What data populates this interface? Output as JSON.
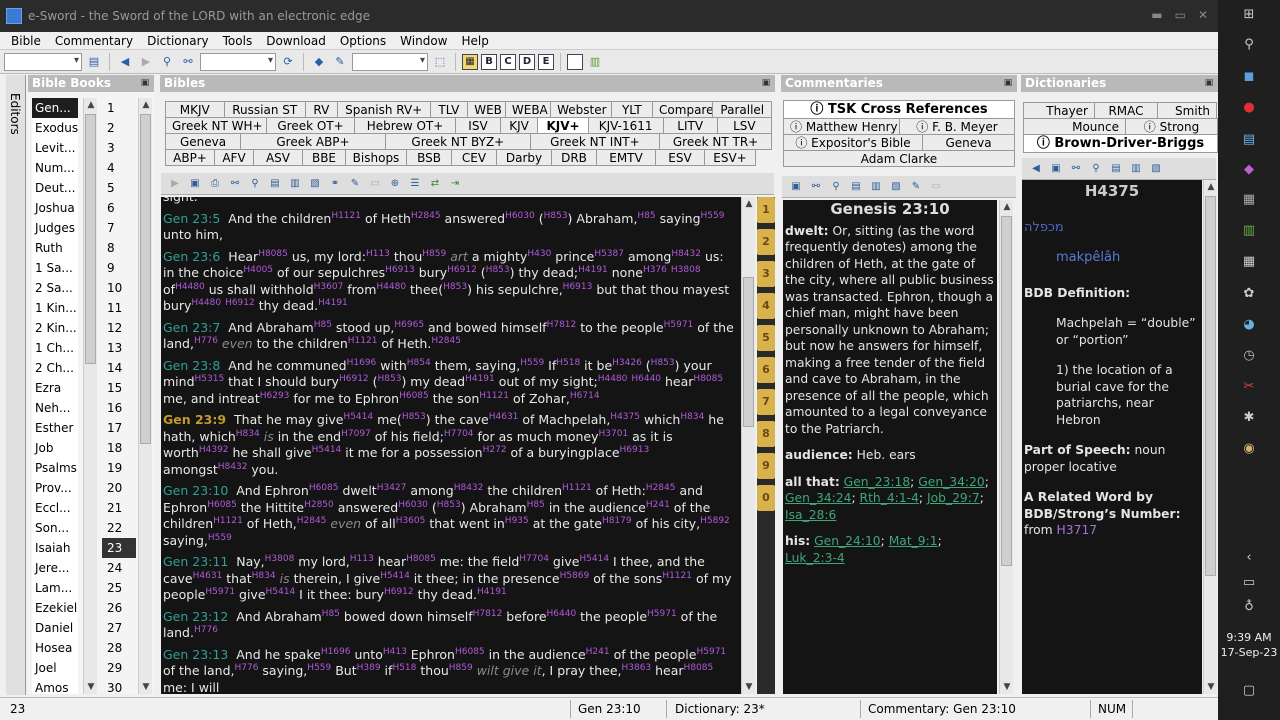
{
  "title": "e-Sword - the Sword of the LORD with an electronic edge",
  "menu": [
    "Bible",
    "Commentary",
    "Dictionary",
    "Tools",
    "Download",
    "Options",
    "Window",
    "Help"
  ],
  "toolbar_letters": [
    "B",
    "C",
    "D",
    "E"
  ],
  "editors_label": "Editors",
  "panels": {
    "bible_books": "Bible Books",
    "bibles": "Bibles",
    "commentaries": "Commentaries",
    "dictionaries": "Dictionaries"
  },
  "books": [
    "Gen...",
    "Exodus",
    "Levit...",
    "Num...",
    "Deut...",
    "Joshua",
    "Judges",
    "Ruth",
    "1 Sa...",
    "2 Sa...",
    "1 Kin...",
    "2 Kin...",
    "1 Ch...",
    "2 Ch...",
    "Ezra",
    "Neh...",
    "Esther",
    "Job",
    "Psalms",
    "Prov...",
    "Eccl...",
    "Son...",
    "Isaiah",
    "Jere...",
    "Lam...",
    "Ezekiel",
    "Daniel",
    "Hosea",
    "Joel",
    "Amos"
  ],
  "selected_book": "Gen...",
  "chapters": [
    "1",
    "2",
    "3",
    "4",
    "5",
    "6",
    "7",
    "8",
    "9",
    "10",
    "11",
    "12",
    "13",
    "14",
    "15",
    "16",
    "17",
    "18",
    "19",
    "20",
    "21",
    "22",
    "23",
    "24",
    "25",
    "26",
    "27",
    "28",
    "29",
    "30"
  ],
  "selected_chapter": "23",
  "bible_tabs": [
    [
      "MKJV",
      "Russian ST",
      "RV",
      "Spanish RV+",
      "TLV",
      "WEB",
      "WEBA",
      "Webster",
      "YLT",
      "Compare",
      "Parallel"
    ],
    [
      "Greek NT WH+",
      "Greek OT+",
      "Hebrew OT+",
      "ISV",
      "KJV",
      "KJV+",
      "KJV-1611",
      "LITV",
      "LSV"
    ],
    [
      "Geneva",
      "Greek ABP+",
      "Greek NT BYZ+",
      "Greek NT INT+",
      "Greek NT TR+"
    ],
    [
      "ABP+",
      "AFV",
      "ASV",
      "BBE",
      "Bishops",
      "BSB",
      "CEV",
      "Darby",
      "DRB",
      "EMTV",
      "ESV",
      "ESV+"
    ]
  ],
  "selected_bible_tab": "KJV+",
  "comm_tabs": {
    "top": "TSK Cross References",
    "row2": [
      "Matthew Henry",
      "F. B. Meyer"
    ],
    "row3": [
      "Expositor's Bible",
      "Geneva"
    ],
    "row4": "Adam Clarke"
  },
  "dict_tabs": {
    "row1": [
      "Thayer",
      "RMAC",
      "Smith"
    ],
    "row2": [
      "Mounce",
      "Strong"
    ],
    "row3": "Brown-Driver-Briggs"
  },
  "chapter_strip": [
    "1",
    "2",
    "3",
    "4",
    "5",
    "6",
    "7",
    "8",
    "9",
    "0"
  ],
  "verses": {
    "top_fragment": "sight.",
    "v5": {
      "ref": "Gen 23:5",
      "text": "And the children<sup>H1121</sup> of Heth<sup>H2845</sup> answered<sup>H6030</sup> (<sup>H853</sup>) Abraham,<sup>H85</sup> saying<sup>H559</sup> unto him,"
    },
    "v6": {
      "ref": "Gen 23:6",
      "text": "Hear<sup>H8085</sup> us, my lord:<sup>H113</sup> thou<sup>H859</sup> <span class=\"it\">art</span> a mighty<sup>H430</sup> prince<sup>H5387</sup> among<sup>H8432</sup> us: in the choice<sup>H4005</sup> of our sepulchres<sup>H6913</sup> bury<sup>H6912</sup> (<sup>H853</sup>) thy dead;<sup>H4191</sup> none<sup>H376</sup> <sup>H3808</sup> of<sup>H4480</sup> us shall withhold<sup>H3607</sup> from<sup>H4480</sup> thee(<sup>H853</sup>) his sepulchre,<sup>H6913</sup> but that thou mayest bury<sup>H4480</sup> <sup>H6912</sup> thy dead.<sup>H4191</sup>"
    },
    "v7": {
      "ref": "Gen 23:7",
      "text": "And Abraham<sup>H85</sup> stood up,<sup>H6965</sup> and bowed himself<sup>H7812</sup> to the people<sup>H5971</sup> of the land,<sup>H776</sup> <span class=\"it\">even</span> to the children<sup>H1121</sup> of Heth.<sup>H2845</sup>"
    },
    "v8": {
      "ref": "Gen 23:8",
      "text": "And he communed<sup>H1696</sup> with<sup>H854</sup> them, saying,<sup>H559</sup> If<sup>H518</sup> it be<sup>H3426</sup> (<sup>H853</sup>) your mind<sup>H5315</sup> that I should bury<sup>H6912</sup> (<sup>H853</sup>) my dead<sup>H4191</sup> out of my sight;<sup>H4480</sup> <sup>H6440</sup> hear<sup>H8085</sup> me, and intreat<sup>H6293</sup> for me to Ephron<sup>H6085</sup> the son<sup>H1121</sup> of Zohar,<sup>H6714</sup>"
    },
    "v9": {
      "ref": "Gen 23:9",
      "text": "That he may give<sup>H5414</sup> me(<sup>H853</sup>) the cave<sup>H4631</sup> of Machpelah,<sup>H4375</sup> which<sup>H834</sup> he hath, which<sup>H834</sup> <span class=\"it\">is</span> in the end<sup>H7097</sup> of his field;<sup>H7704</sup> for as much money<sup>H3701</sup> as it is worth<sup>H4392</sup> he shall give<sup>H5414</sup> it me for a possession<sup>H272</sup> of a buryingplace<sup>H6913</sup> amongst<sup>H8432</sup> you."
    },
    "v10": {
      "ref": "Gen 23:10",
      "text": "And Ephron<sup>H6085</sup> dwelt<sup>H3427</sup> among<sup>H8432</sup> the children<sup>H1121</sup> of Heth:<sup>H2845</sup> and Ephron<sup>H6085</sup> the Hittite<sup>H2850</sup> answered<sup>H6030</sup> (<sup>H853</sup>) Abraham<sup>H85</sup> in the audience<sup>H241</sup> of the children<sup>H1121</sup> of Heth,<sup>H2845</sup> <span class=\"it\">even</span> of all<sup>H3605</sup> that went in<sup>H935</sup> at the gate<sup>H8179</sup> of his city,<sup>H5892</sup> saying,<sup>H559</sup>"
    },
    "v11": {
      "ref": "Gen 23:11",
      "text": "Nay,<sup>H3808</sup> my lord,<sup>H113</sup> hear<sup>H8085</sup> me: the field<sup>H7704</sup> give<sup>H5414</sup> I thee, and the cave<sup>H4631</sup> that<sup>H834</sup> <span class=\"it\">is</span> therein, I give<sup>H5414</sup> it thee; in the presence<sup>H5869</sup> of the sons<sup>H1121</sup> of my people<sup>H5971</sup> give<sup>H5414</sup> I it thee: bury<sup>H6912</sup> thy dead.<sup>H4191</sup>"
    },
    "v12": {
      "ref": "Gen 23:12",
      "text": "And Abraham<sup>H85</sup> bowed down himself<sup>H7812</sup> before<sup>H6440</sup> the people<sup>H5971</sup> of the land.<sup>H776</sup>"
    },
    "v13": {
      "ref": "Gen 23:13",
      "text": "And he spake<sup>H1696</sup> unto<sup>H413</sup> Ephron<sup>H6085</sup> in the audience<sup>H241</sup> of the people<sup>H5971</sup> of the land,<sup>H776</sup> saying,<sup>H559</sup> But<sup>H389</sup> if<sup>H518</sup> thou<sup>H859</sup> <span class=\"it\">wilt give it</span>, I pray thee,<sup>H3863</sup> hear<sup>H8085</sup> me: I will"
    }
  },
  "commentary": {
    "heading": "Genesis 23:10",
    "dwelt_label": "dwelt:",
    "dwelt_text": "Or, sitting (as the word frequently denotes) among the children of Heth, at the gate of the city, where all public business was transacted. Ephron, though a chief man, might have been personally unknown to Abraham; but now he answers for himself, making a free tender of the field and cave to Abraham, in the presence of all the people, which amounted to a legal conveyance to the Patriarch.",
    "audience_label": "audience:",
    "audience_text": "Heb. ears",
    "allthat_label": "all that:",
    "allthat_refs": [
      "Gen_23:18",
      "Gen_34:20",
      "Gen_34:24",
      "Rth_4:1-4",
      "Job_29:7",
      "Isa_28:6"
    ],
    "his_label": "his:",
    "his_refs": [
      "Gen_24:10",
      "Mat_9:1",
      "Luk_2:3-4"
    ]
  },
  "dictionary": {
    "heading": "H4375",
    "hebrew": "מכפלה",
    "translit": "makpêlâh",
    "bdb_label": "BDB Definition:",
    "def1": "Machpelah = “double” or “portion”",
    "def2": "1) the location of a burial cave for the patriarchs, near Hebron",
    "pos_label": "Part of Speech:",
    "pos_text": "noun proper locative",
    "related_label": "A Related Word by BDB/Strong’s Number:",
    "related_from": "from",
    "related_ref": "H3717"
  },
  "status": {
    "chapter": "23",
    "verse": "Gen 23:10",
    "dictionary": "Dictionary: 23*",
    "commentary": "Commentary: Gen 23:10",
    "num": "NUM"
  },
  "clock": {
    "time": "9:39 AM",
    "date": "17-Sep-23"
  }
}
